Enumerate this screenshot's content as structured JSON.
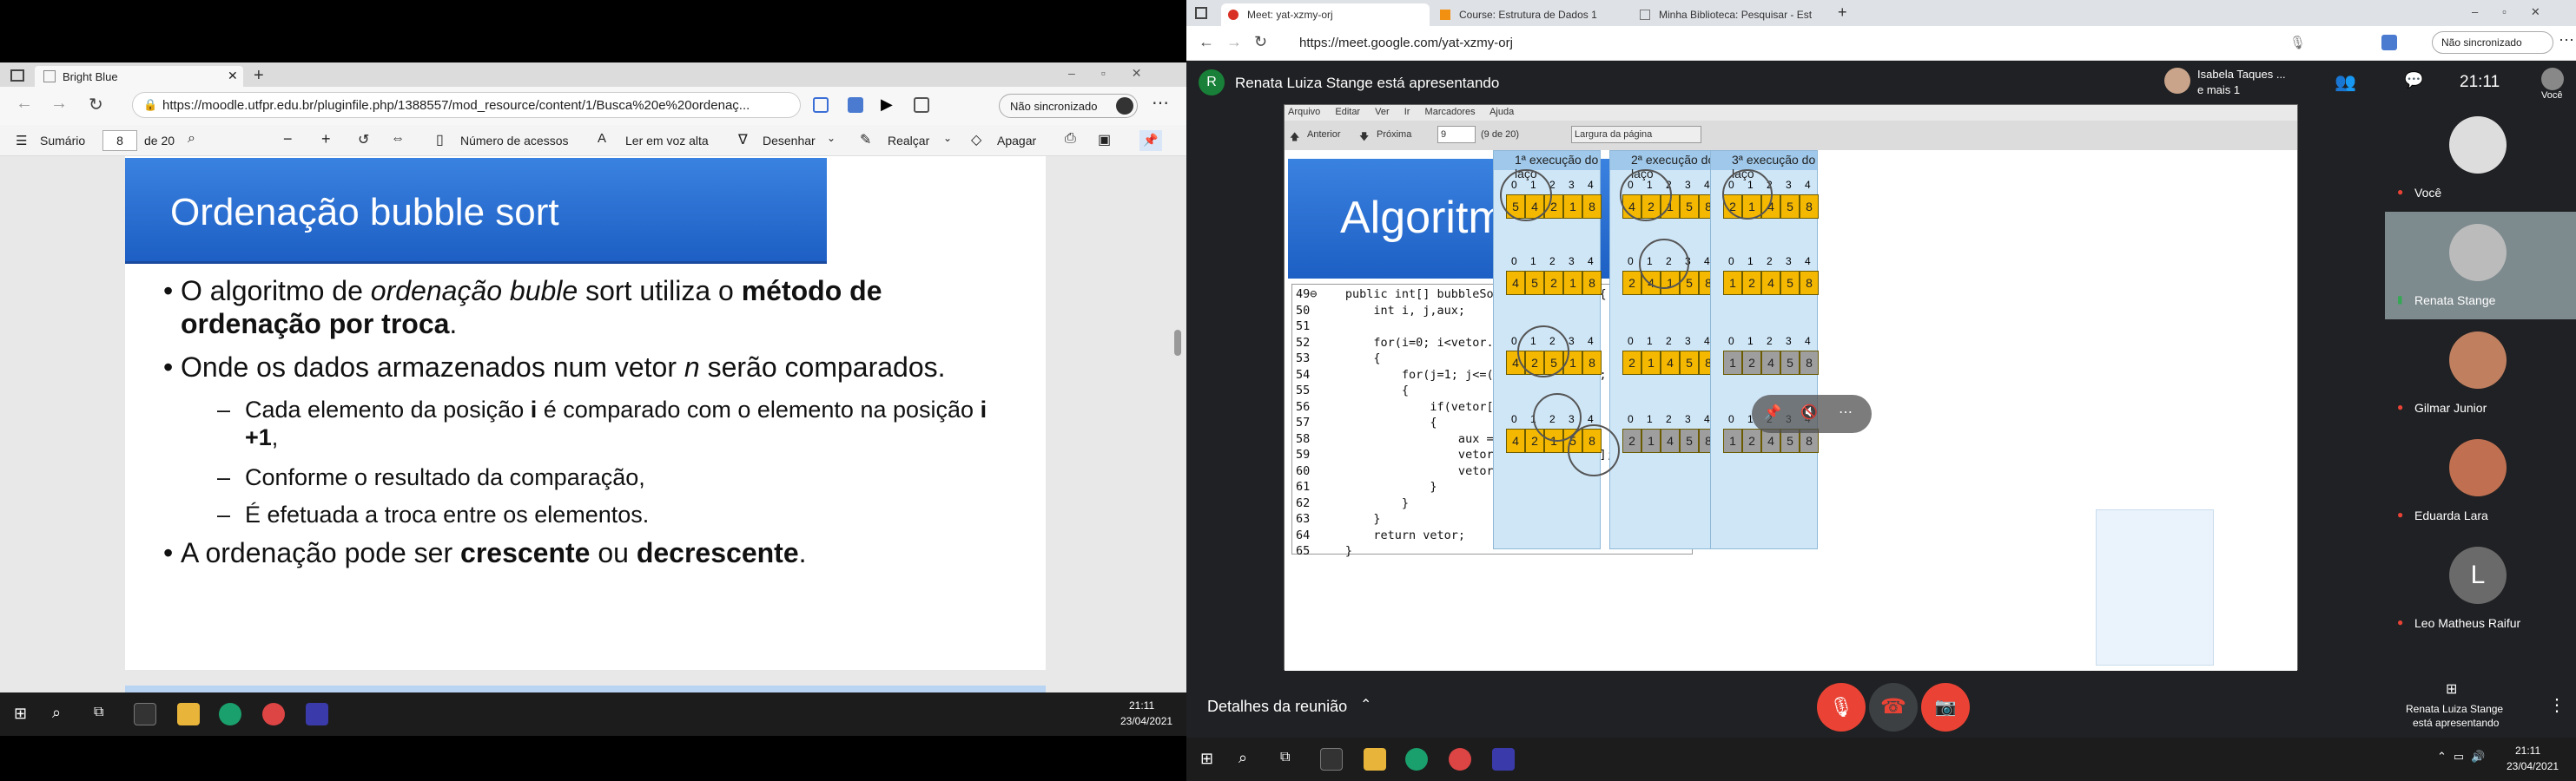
{
  "left_window": {
    "tab_title": "Bright Blue",
    "url": "https://moodle.utfpr.edu.br/pluginfile.php/1388557/mod_resource/content/1/Busca%20e%20ordenaç...",
    "sync_label": "Não sincronizado",
    "toolbar": {
      "contents": "Sumário",
      "page_current": "8",
      "page_total": "de 20",
      "access_count": "Número de acessos",
      "read_aloud": "Ler em voz alta",
      "draw": "Desenhar",
      "highlight": "Realçar",
      "erase": "Apagar"
    },
    "slide": {
      "title": "Ordenação bubble sort",
      "b1_a": "O algoritmo de ",
      "b1_b": "ordenação buble",
      "b1_c": " sort utiliza o ",
      "b1_d": "método de ordenação por troca",
      "b1_e": ".",
      "b2_a": "Onde os dados armazenados num vetor ",
      "b2_b": "n",
      "b2_c": " serão comparados.",
      "s1_a": "Cada elemento da posição ",
      "s1_b": "i",
      "s1_c": " é comparado com o elemento na posição ",
      "s1_d": "i +1",
      "s1_e": ",",
      "s2": "Conforme o resultado da comparação,",
      "s3": "É efetuada a troca entre os elementos.",
      "b3_a": "A ordenação pode ser ",
      "b3_b": "crescente",
      "b3_c": " ou ",
      "b3_d": "decrescente",
      "b3_e": "."
    },
    "clock_time": "21:11",
    "clock_date": "23/04/2021"
  },
  "right_window": {
    "tabs": [
      "Meet: yat-xzmy-orj",
      "Course: Estrutura de Dados 1",
      "Minha Biblioteca: Pesquisar - Est"
    ],
    "url": "https://meet.google.com/yat-xzmy-orj",
    "sync_label": "Não sincronizado",
    "presenter_initial": "R",
    "presenter_text": "Renata Luiza Stange está apresentando",
    "viewer_text_1": "Isabela Taques ...",
    "viewer_text_2": "e mais 1",
    "meet_time": "21:11",
    "you_label": "Você",
    "participants": [
      {
        "name": "Você",
        "muted": true
      },
      {
        "name": "Renata Stange",
        "muted": false
      },
      {
        "name": "Gilmar Junior",
        "muted": true
      },
      {
        "name": "Eduarda Lara",
        "muted": true
      },
      {
        "name": "Leo Matheus Raifur",
        "muted": true
      }
    ],
    "participant_initial": "L",
    "meeting_details": "Detalhes da reunião",
    "bottom_right_1": "Renata Luiza Stange",
    "bottom_right_2": "está apresentando",
    "clock_time": "21:11",
    "clock_date": "23/04/2021",
    "presentation": {
      "menu": [
        "Arquivo",
        "Editar",
        "Ver",
        "Ir",
        "Marcadores",
        "Ajuda"
      ],
      "prev": "Anterior",
      "next": "Próxima",
      "page": "9",
      "page_of": "(9 de 20)",
      "zoom": "Largura da página",
      "algo_title": "Algoritmo",
      "code_lines": [
        "49⊖    public int[] bubbleSort(int vetor[]){",
        "50         int i, j,aux;",
        "51",
        "52         for(i=0; i<vetor.length; i++)",
        "53         {",
        "54             for(j=1; j<=(vetor.length)-1; j++)",
        "55             {",
        "56                 if(vetor[j-1]>vetor[j])",
        "57                 {",
        "58                     aux = vetor[j];",
        "59                     vetor[j] = vetor[j-1];",
        "60                     vetor[j-1] = aux;",
        "61                 }",
        "62             }",
        "63         }",
        "64         return vetor;",
        "65     }"
      ],
      "exec_titles": [
        "1ª execução do laço",
        "2ª execução do laço",
        "3ª execução do laço"
      ],
      "indices": [
        "0",
        "1",
        "2",
        "3",
        "4"
      ],
      "arrays": [
        [
          [
            "5",
            "4",
            "2",
            "1",
            "8"
          ],
          [
            "4",
            "5",
            "2",
            "1",
            "8"
          ],
          [
            "4",
            "2",
            "5",
            "1",
            "8"
          ],
          [
            "4",
            "2",
            "1",
            "5",
            "8"
          ]
        ],
        [
          [
            "4",
            "2",
            "1",
            "5",
            "8"
          ],
          [
            "2",
            "4",
            "1",
            "5",
            "8"
          ],
          [
            "2",
            "1",
            "4",
            "5",
            "8"
          ],
          [
            "2",
            "1",
            "4",
            "5",
            "8"
          ]
        ],
        [
          [
            "2",
            "1",
            "4",
            "5",
            "8"
          ],
          [
            "1",
            "2",
            "4",
            "5",
            "8"
          ],
          [
            "1",
            "2",
            "4",
            "5",
            "8"
          ],
          [
            "1",
            "2",
            "4",
            "5",
            "8"
          ]
        ]
      ]
    }
  }
}
